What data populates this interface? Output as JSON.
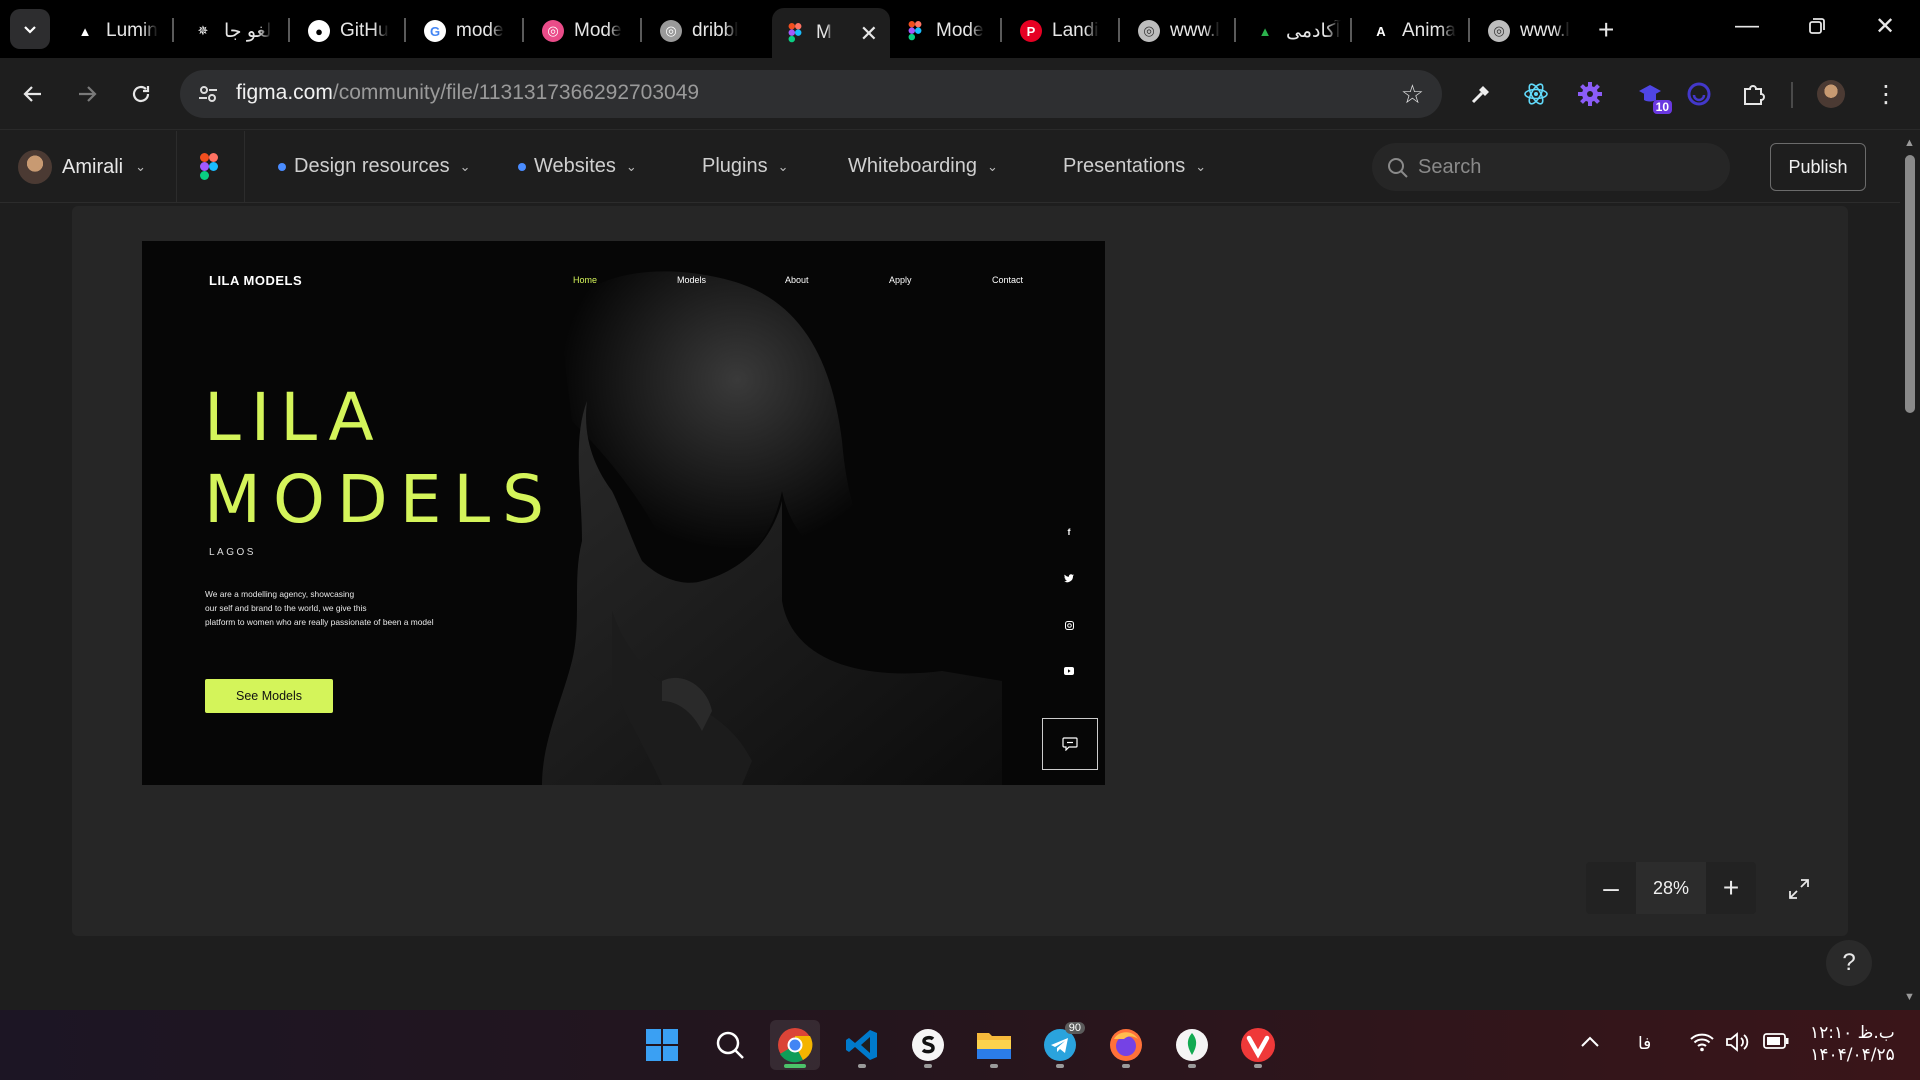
{
  "browser": {
    "tabs": [
      {
        "title": "Lumin",
        "icon": "triangle-icon",
        "fav_bg": "#000000",
        "fav_color": "#ffffff"
      },
      {
        "title": "لغو جا",
        "icon": "openai-icon",
        "fav_bg": "#000000",
        "fav_color": "#ffffff"
      },
      {
        "title": "GitHu",
        "icon": "github-icon",
        "fav_bg": "#ffffff",
        "fav_color": "#000000"
      },
      {
        "title": "mode",
        "icon": "google-icon",
        "fav_bg": "#ffffff",
        "fav_color": "#4285f4"
      },
      {
        "title": "Mode",
        "icon": "dribbble-icon",
        "fav_bg": "#ea4c89",
        "fav_color": "#ffffff"
      },
      {
        "title": "dribbl",
        "icon": "dribbble-grey-icon",
        "fav_bg": "#9a9a9a",
        "fav_color": "#ffffff"
      },
      {
        "title": "M",
        "icon": "figma-icon",
        "fav_bg": "transparent",
        "fav_color": "#ffffff"
      },
      {
        "title": "Mode",
        "icon": "figma-icon",
        "fav_bg": "transparent",
        "fav_color": "#ffffff"
      },
      {
        "title": "Landi",
        "icon": "pinterest-icon",
        "fav_bg": "#e60023",
        "fav_color": "#ffffff"
      },
      {
        "title": "www.l",
        "icon": "globe-icon",
        "fav_bg": "#bdbdbd",
        "fav_color": "#333333"
      },
      {
        "title": "آکادمی",
        "icon": "academy-icon",
        "fav_bg": "transparent",
        "fav_color": "#2bb24c"
      },
      {
        "title": "Anima",
        "icon": "anima-icon",
        "fav_bg": "transparent",
        "fav_color": "#ffffff"
      },
      {
        "title": "www.l",
        "icon": "globe-icon",
        "fav_bg": "#bdbdbd",
        "fav_color": "#333333"
      }
    ],
    "active_tab_index": 6,
    "url_host": "figma.com",
    "url_path": "/community/file/1131317366292703049",
    "extension_badge": "10"
  },
  "figma": {
    "user_name": "Amirali",
    "nav": [
      {
        "label": "Design resources",
        "dot": "#4a8cff"
      },
      {
        "label": "Websites",
        "dot": "#4a8cff"
      },
      {
        "label": "Plugins",
        "dot": ""
      },
      {
        "label": "Whiteboarding",
        "dot": ""
      },
      {
        "label": "Presentations",
        "dot": ""
      }
    ],
    "search_placeholder": "Search",
    "publish_label": "Publish",
    "zoom_level": "28%",
    "help_label": "?"
  },
  "design": {
    "brand": "LILA MODELS",
    "menu": [
      "Home",
      "Models",
      "About",
      "Apply",
      "Contact"
    ],
    "hero_line1": "LILA",
    "hero_line2": "MODELS",
    "city": "LAGOS",
    "description_lines": [
      "We are a modelling agency, showcasing",
      "our self and brand to the world, we give this",
      "platform to women who are really passionate of been a model"
    ],
    "cta_label": "See Models",
    "social": [
      "f",
      "twitter",
      "instagram",
      "youtube"
    ],
    "accent_color": "#d4f45a"
  },
  "taskbar": {
    "apps": [
      "windows-start",
      "search",
      "chrome",
      "vscode",
      "app-s",
      "file-explorer",
      "telegram",
      "firefox",
      "mongodb",
      "vivaldi"
    ],
    "telegram_badge": "90",
    "language": "فا",
    "time": "۱۲:۱۰ ب.ظ",
    "date": "۱۴۰۴/۰۴/۲۵"
  }
}
